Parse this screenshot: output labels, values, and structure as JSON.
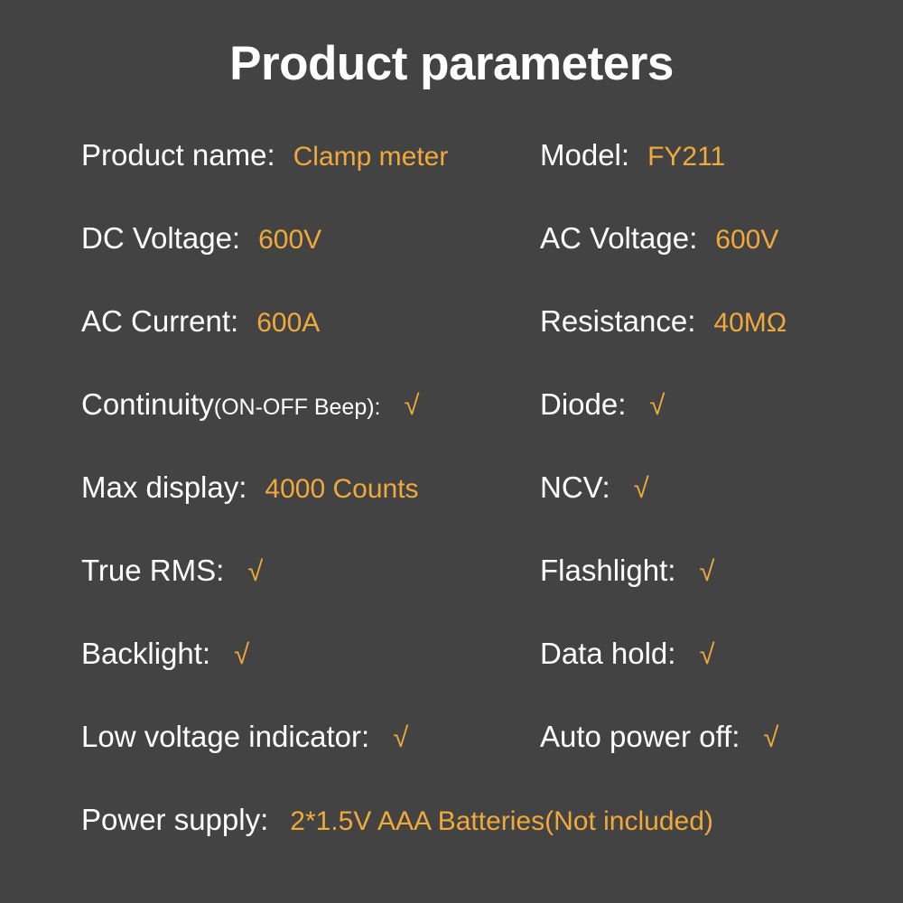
{
  "title": "Product parameters",
  "colors": {
    "background": "#434343",
    "label": "#ffffff",
    "value": "#efa93c"
  },
  "check_glyph": "√",
  "rows": [
    {
      "left": {
        "label": "Product name:",
        "value": "Clamp meter"
      },
      "right": {
        "label": "Model:",
        "value": "FY211"
      }
    },
    {
      "left": {
        "label": "DC Voltage:",
        "value": "600V"
      },
      "right": {
        "label": "AC Voltage:",
        "value": "600V"
      }
    },
    {
      "left": {
        "label": "AC Current:",
        "value": "600A"
      },
      "right": {
        "label": "Resistance:",
        "value": "40MΩ"
      }
    },
    {
      "left": {
        "label": "Continuity",
        "note": "(ON-OFF Beep):",
        "value": "√"
      },
      "right": {
        "label": "Diode:",
        "value": "√"
      }
    },
    {
      "left": {
        "label": "Max display:",
        "value": "4000 Counts"
      },
      "right": {
        "label": "NCV:",
        "value": "√"
      }
    },
    {
      "left": {
        "label": "True RMS:",
        "value": "√"
      },
      "right": {
        "label": "Flashlight:",
        "value": "√"
      }
    },
    {
      "left": {
        "label": "Backlight:",
        "value": "√"
      },
      "right": {
        "label": "Data hold:",
        "value": "√"
      }
    },
    {
      "left": {
        "label": "Low voltage indicator:",
        "value": "√"
      },
      "right": {
        "label": "Auto power off:",
        "value": "√"
      }
    },
    {
      "left": {
        "label": "Power supply:",
        "value": "2*1.5V AAA Batteries(Not included)"
      }
    }
  ]
}
